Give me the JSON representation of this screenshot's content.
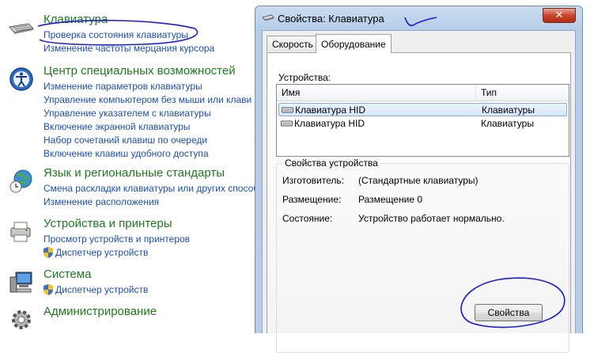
{
  "control_panel": {
    "categories": [
      {
        "icon": "keyboard-icon",
        "title": "Клавиатура",
        "links": [
          "Проверка состояния клавиатуры",
          "Изменение частоты мерцания курсора"
        ]
      },
      {
        "icon": "ease-of-access-icon",
        "title": "Центр специальных возможностей",
        "links": [
          "Изменение параметров клавиатуры",
          "Управление компьютером без мыши или клави",
          "Управление указателем с клавиатуры",
          "Включение экранной клавиатуры",
          "Набор сочетаний клавиш по очереди",
          "Включение клавиш удобного доступа"
        ]
      },
      {
        "icon": "globe-clock-icon",
        "title": "Язык и региональные стандарты",
        "links": [
          "Смена раскладки клавиатуры или других способ",
          "Изменение расположения"
        ]
      },
      {
        "icon": "printer-icon",
        "title": "Устройства и принтеры",
        "links": [
          "Просмотр устройств и принтеров",
          "Диспетчер устройств"
        ]
      },
      {
        "icon": "computer-icon",
        "title": "Система",
        "links": [
          "Диспетчер устройств"
        ]
      },
      {
        "icon": "gear-icon",
        "title": "Администрирование",
        "links": []
      }
    ]
  },
  "dialog": {
    "title": "Свойства: Клавиатура",
    "close_label": "✕",
    "tabs": [
      "Скорость",
      "Оборудование"
    ],
    "active_tab": "Оборудование",
    "devices_label": "Устройства:",
    "columns": [
      "Имя",
      "Тип"
    ],
    "devices": [
      {
        "name": "Клавиатура HID",
        "type": "Клавиатуры"
      },
      {
        "name": "Клавиатура HID",
        "type": "Клавиатуры"
      }
    ],
    "properties_group_title": "Свойства устройства",
    "properties": [
      {
        "label": "Изготовитель:",
        "value": "(Стандартные клавиатуры)"
      },
      {
        "label": "Размещение:",
        "value": "Размещение 0"
      },
      {
        "label": "Состояние:",
        "value": "Устройство работает нормально."
      }
    ],
    "properties_button": "Свойства"
  },
  "colors": {
    "category_title": "#1e7a1e",
    "link": "#1a4fb0",
    "annotation": "#1a1ad0"
  }
}
